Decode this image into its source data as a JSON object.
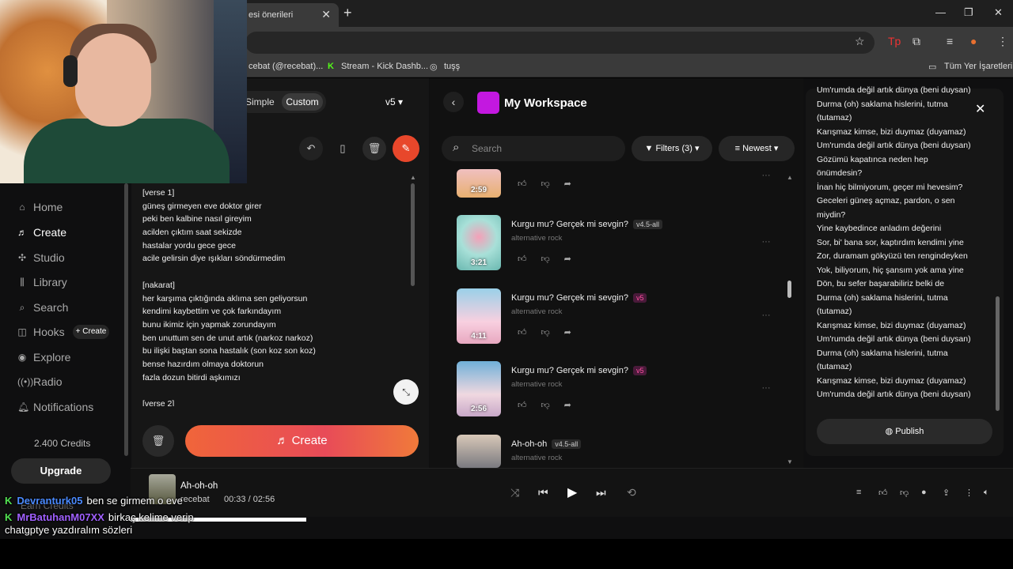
{
  "browser": {
    "tab_title": "esi önerileri",
    "tab_close": "✕",
    "new_tab": "+",
    "bookmarks": [
      {
        "label": "cebat (@recebat)..."
      },
      {
        "label": "Stream - Kick Dashb..."
      },
      {
        "label": "tuşş"
      },
      {
        "label": "Tüm Yer İşaretleri"
      }
    ]
  },
  "sidebar": {
    "items": [
      {
        "label": "Home",
        "icon": "home-icon"
      },
      {
        "label": "Create",
        "icon": "create-icon"
      },
      {
        "label": "Studio",
        "icon": "studio-icon"
      },
      {
        "label": "Library",
        "icon": "library-icon"
      },
      {
        "label": "Search",
        "icon": "search-icon"
      },
      {
        "label": "Hooks",
        "icon": "hooks-icon"
      },
      {
        "label": "Explore",
        "icon": "explore-icon"
      },
      {
        "label": "Radio",
        "icon": "radio-icon"
      },
      {
        "label": "Notifications",
        "icon": "bell-icon"
      }
    ],
    "hooks_create": "+ Create",
    "credits": "2.400 Credits",
    "upgrade": "Upgrade",
    "earn_credits": "Earn Credits"
  },
  "create": {
    "mode_simple": "Simple",
    "mode_custom": "Custom",
    "version": "v5",
    "create_label": "Create",
    "lyrics": [
      "[verse 1]",
      "güneş girmeyen eve doktor girer",
      "peki ben kalbine nasıl gireyim",
      "acilden çıktım saat sekizde",
      "hastalar yordu gece gece",
      "acile gelirsin diye ışıkları söndürmedim",
      "",
      "[nakarat]",
      "her karşıma çıktığında aklıma sen geliyorsun",
      "kendimi kaybettim ve çok farkındayım",
      "bunu ikimiz için yapmak zorundayım",
      "ben unuttum sen de unut artık (narkoz narkoz)",
      "bu ilişki baştan sona hastalık (son koz son koz)",
      "bense hazırdım olmaya doktorun",
      "fazla dozun bitirdi aşkımızı",
      "",
      "[verse 2]"
    ]
  },
  "workspace": {
    "title": "My Workspace",
    "search_placeholder": "Search",
    "filters": "Filters (3)",
    "sort": "Newest",
    "songs": [
      {
        "title": "",
        "version": "",
        "genre": "",
        "duration": "2:59"
      },
      {
        "title": "Kurgu mu? Gerçek mi sevgin?",
        "version": "v4.5-all",
        "genre": "alternative rock",
        "duration": "3:21"
      },
      {
        "title": "Kurgu mu? Gerçek mi sevgin?",
        "version": "v5",
        "genre": "alternative rock",
        "duration": "4:11"
      },
      {
        "title": "Kurgu mu? Gerçek mi sevgin?",
        "version": "v5",
        "genre": "alternative rock",
        "duration": "2:56"
      },
      {
        "title": "Ah-oh-oh",
        "version": "v4.5-all",
        "genre": "alternative rock",
        "duration": ""
      }
    ]
  },
  "lyrics_panel": {
    "lines": [
      "Um'rumda değil artık dünya (beni duysan)",
      "Durma (oh) saklama hislerini, tutma",
      "(tutamaz)",
      "Karışmaz kimse, bizi duymaz (duyamaz)",
      "Um'rumda değil artık dünya (beni duysan)",
      "Gözümü kapatınca neden hep",
      "önümdesin?",
      "İnan hiç bilmiyorum, geçer mi hevesim?",
      "Geceleri güneş açmaz, pardon, o sen",
      "miydin?",
      "Yine kaybedince anladım değerini",
      "Sor, bi' bana sor, kaptırdım kendimi yine",
      "Zor, duramam gökyüzü ten rengindeyken",
      "Yok, biliyorum, hiç şansım yok ama yine",
      "Dön, bu sefer başarabiliriz belki de",
      "Durma (oh) saklama hislerini, tutma",
      "(tutamaz)",
      "Karışmaz kimse, bizi duymaz (duyamaz)",
      "Um'rumda değil artık dünya (beni duysan)",
      "Durma (oh) saklama hislerini, tutma",
      "(tutamaz)",
      "Karışmaz kimse, bizi duymaz (duyamaz)",
      "Um'rumda değil artık dünya (beni duysan)"
    ],
    "publish": "Publish"
  },
  "player": {
    "title": "Ah-oh-oh",
    "artist": "recebat",
    "time": "00:33 / 02:56"
  },
  "chat": [
    {
      "user": "Devranturk05",
      "message": "ben se girmem o eve"
    },
    {
      "user": "MrBatuhanM07XX",
      "message": "birkaç kelime verip"
    },
    {
      "user": "",
      "message": "chatgptye yazdıralım sözleri"
    }
  ]
}
